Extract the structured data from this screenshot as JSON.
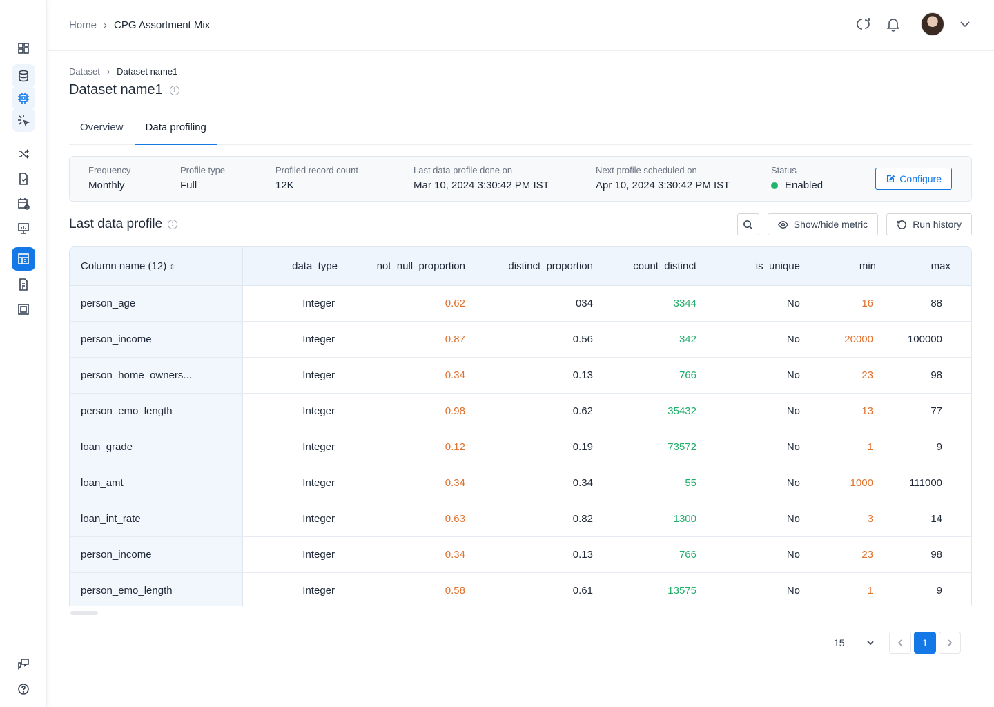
{
  "header": {
    "breadcrumb": [
      "Home",
      "CPG Assortment Mix"
    ]
  },
  "page": {
    "breadcrumb": [
      "Dataset",
      "Dataset name1"
    ],
    "title": "Dataset name1",
    "tabs": [
      "Overview",
      "Data profiling"
    ],
    "active_tab": "Data profiling"
  },
  "summary": {
    "frequency_label": "Frequency",
    "frequency": "Monthly",
    "profile_type_label": "Profile type",
    "profile_type": "Full",
    "record_count_label": "Profiled record count",
    "record_count": "12K",
    "last_done_label": "Last data profile done on",
    "last_done": "Mar 10, 2024 3:30:42 PM IST",
    "next_label": "Next profile scheduled on",
    "next": "Apr 10, 2024 3:30:42 PM IST",
    "status_label": "Status",
    "status": "Enabled",
    "configure_label": "Configure"
  },
  "section": {
    "title": "Last data profile",
    "show_hide_label": "Show/hide metric",
    "run_history_label": "Run history"
  },
  "table": {
    "columns": [
      "Column name (12)",
      "data_type",
      "not_null_proportion",
      "distinct_proportion",
      "count_distinct",
      "is_unique",
      "min",
      "max"
    ],
    "rows": [
      [
        "person_age",
        "Integer",
        "0.62",
        "034",
        "3344",
        "No",
        "16",
        "88"
      ],
      [
        "person_income",
        "Integer",
        "0.87",
        "0.56",
        "342",
        "No",
        "20000",
        "100000"
      ],
      [
        "person_home_owners...",
        "Integer",
        "0.34",
        "0.13",
        "766",
        "No",
        "23",
        "98"
      ],
      [
        "person_emo_length",
        "Integer",
        "0.98",
        "0.62",
        "35432",
        "No",
        "13",
        "77"
      ],
      [
        "loan_grade",
        "Integer",
        "0.12",
        "0.19",
        "73572",
        "No",
        "1",
        "9"
      ],
      [
        "loan_amt",
        "Integer",
        "0.34",
        "0.34",
        "55",
        "No",
        "1000",
        "111000"
      ],
      [
        "loan_int_rate",
        "Integer",
        "0.63",
        "0.82",
        "1300",
        "No",
        "3",
        "14"
      ],
      [
        "person_income",
        "Integer",
        "0.34",
        "0.13",
        "766",
        "No",
        "23",
        "98"
      ],
      [
        "person_emo_length",
        "Integer",
        "0.58",
        "0.61",
        "13575",
        "No",
        "1",
        "9"
      ]
    ]
  },
  "pagination": {
    "page_size": "15",
    "current_page": "1"
  },
  "colors": {
    "accent": "#1478e6",
    "orange": "#e0722e",
    "green": "#1fae6a",
    "status_enabled": "#1fb56b"
  }
}
